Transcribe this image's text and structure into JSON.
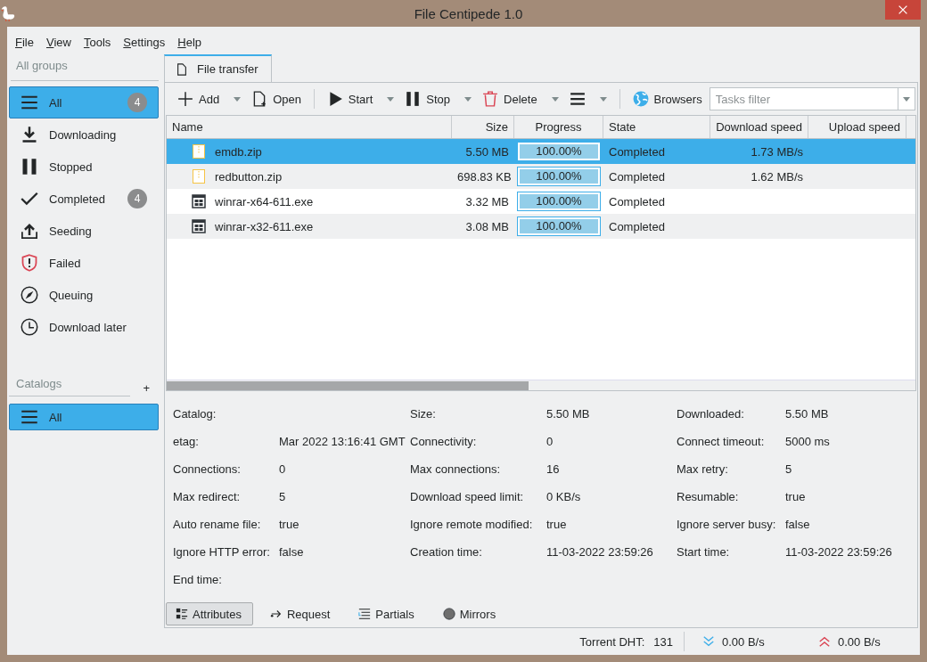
{
  "window": {
    "title": "File Centipede 1.0"
  },
  "menu": [
    "File",
    "View",
    "Tools",
    "Settings",
    "Help"
  ],
  "sidebar": {
    "groups_heading": "All groups",
    "groups": [
      {
        "label": "All",
        "badge": "4",
        "selected": true
      },
      {
        "label": "Downloading",
        "selected": false
      },
      {
        "label": "Stopped",
        "selected": false
      },
      {
        "label": "Completed",
        "badge": "4",
        "selected": false
      },
      {
        "label": "Seeding",
        "selected": false
      },
      {
        "label": "Failed",
        "selected": false
      },
      {
        "label": "Queuing",
        "selected": false
      },
      {
        "label": "Download later",
        "selected": false
      }
    ],
    "catalogs_heading": "Catalogs",
    "catalogs_add": "+",
    "catalogs": [
      {
        "label": "All",
        "selected": true
      }
    ]
  },
  "tabs": [
    {
      "label": "File transfer",
      "selected": true
    }
  ],
  "toolbar": [
    [
      {
        "label": "Add",
        "dropdown": true
      },
      {
        "label": "Open",
        "dropdown": false
      }
    ],
    [
      {
        "label": "Start",
        "dropdown": true
      },
      {
        "label": "Stop",
        "dropdown": true
      },
      {
        "label": "Delete",
        "dropdown": true
      },
      {
        "dropdown": true
      }
    ],
    [
      {
        "label": "Browsers",
        "dropdown": false
      }
    ]
  ],
  "filter": {
    "placeholder": "Tasks filter"
  },
  "table": {
    "columns": [
      "Name",
      "Size",
      "Progress",
      "State",
      "Download speed",
      "Upload speed"
    ],
    "rows": [
      {
        "kind": "archive",
        "name": "emdb.zip",
        "size": "5.50 MB",
        "level": 1,
        "progress": "100.00%",
        "state": "Completed",
        "download_speed": "1.73 MB/s",
        "selected": true
      },
      {
        "kind": "archive",
        "name": "redbutton.zip",
        "size": "698.83 KB",
        "level": 1,
        "progress": "100.00%",
        "state": "Completed",
        "download_speed": "1.62 MB/s",
        "selected": false
      },
      {
        "kind": "program",
        "name": "winrar-x64-611.exe",
        "size": "3.32 MB",
        "level": 1,
        "progress": "100.00%",
        "state": "Completed",
        "selected": false
      },
      {
        "kind": "program",
        "name": "winrar-x32-611.exe",
        "size": "3.08 MB",
        "level": 1,
        "progress": "100.00%",
        "state": "Completed",
        "selected": false
      }
    ]
  },
  "attributes": [
    {
      "label": "Catalog:"
    },
    {
      "label": "Size:",
      "value": "5.50 MB"
    },
    {
      "label": "Downloaded:",
      "value": "5.50 MB"
    },
    {
      "label": "etag:",
      "value": "Mar 2022 13:16:41 GMT"
    },
    {
      "label": "Connectivity:",
      "value": "0"
    },
    {
      "label": "Connect timeout:",
      "value": "5000 ms"
    },
    {
      "label": "Connections:",
      "value": "0"
    },
    {
      "label": "Max connections:",
      "value": "16"
    },
    {
      "label": "Max retry:",
      "value": "5"
    },
    {
      "label": "Max redirect:",
      "value": "5"
    },
    {
      "label": "Download speed limit:",
      "value": "0 KB/s"
    },
    {
      "label": "Resumable:",
      "value": "true"
    },
    {
      "label": "Auto rename file:",
      "value": "true"
    },
    {
      "label": "Ignore remote modified:",
      "value": "true"
    },
    {
      "label": "Ignore server busy:",
      "value": "false"
    },
    {
      "label": "Ignore HTTP error:",
      "value": "false"
    },
    {
      "label": "Creation time:",
      "value": "11-03-2022 23:59:26"
    },
    {
      "label": "Start time:",
      "value": "11-03-2022 23:59:26"
    },
    {
      "label": "End time:"
    }
  ],
  "detail_tabs": [
    {
      "label": "Attributes",
      "selected": true
    },
    {
      "label": "Request",
      "selected": false
    },
    {
      "label": "Partials",
      "selected": false
    },
    {
      "label": "Mirrors",
      "selected": false
    }
  ],
  "status_bar": {
    "dht_label": "Torrent DHT:",
    "dht_value": "131",
    "download_speed": "0.00 B/s",
    "upload_speed": "0.00 B/s"
  }
}
